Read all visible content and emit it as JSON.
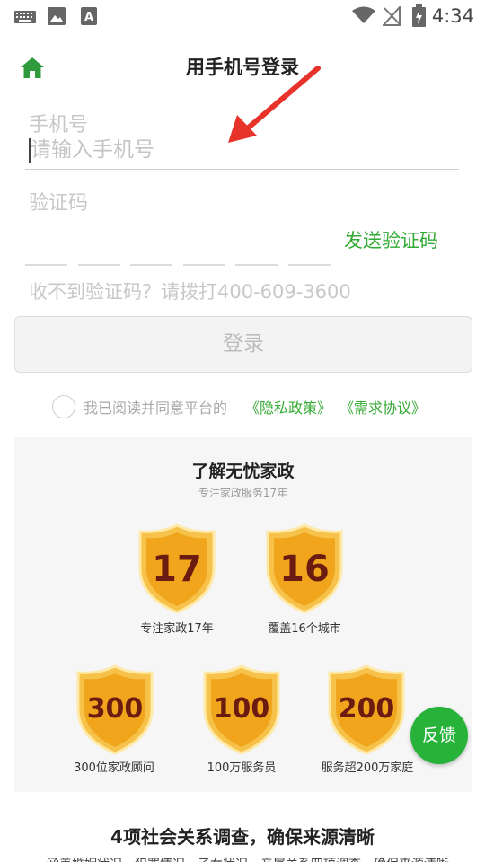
{
  "status_bar": {
    "time": "4:34",
    "left_icons": [
      "keyboard-icon",
      "image-icon",
      "a-icon"
    ],
    "right_icons": [
      "wifi-icon",
      "no-signal-icon",
      "battery-charging-icon"
    ]
  },
  "header": {
    "title": "用手机号登录",
    "home_icon": "home-icon"
  },
  "form": {
    "phone_label": "手机号",
    "phone_placeholder": "请输入手机号",
    "code_label": "验证码",
    "send_code_label": "发送验证码",
    "help_text": "收不到验证码？请拨打400-609-3600",
    "login_label": "登录",
    "agree_text": "我已阅读并同意平台的",
    "privacy_link": "《隐私政策》",
    "agreement_link": "《需求协议》"
  },
  "info": {
    "title": "了解无忧家政",
    "subtitle": "专注家政服务17年",
    "badges": [
      {
        "number": "17",
        "caption": "专注家政17年"
      },
      {
        "number": "16",
        "caption": "覆盖16个城市"
      },
      {
        "number": "300",
        "caption": "300位家政顾问"
      },
      {
        "number": "100",
        "caption": "100万服务员"
      },
      {
        "number": "200",
        "caption": "服务超200万家庭"
      }
    ]
  },
  "feedback_label": "反馈",
  "bottom": {
    "title": "4项社会关系调查，确保来源清晰",
    "cut_text": "涵盖婚姻状况、犯罪情况、子女状况、亲属关系四项调查，确保来源清晰"
  },
  "colors": {
    "accent_green": "#33aa33",
    "arrow_red": "#e8332a",
    "shield_gold": "#f5b323"
  }
}
